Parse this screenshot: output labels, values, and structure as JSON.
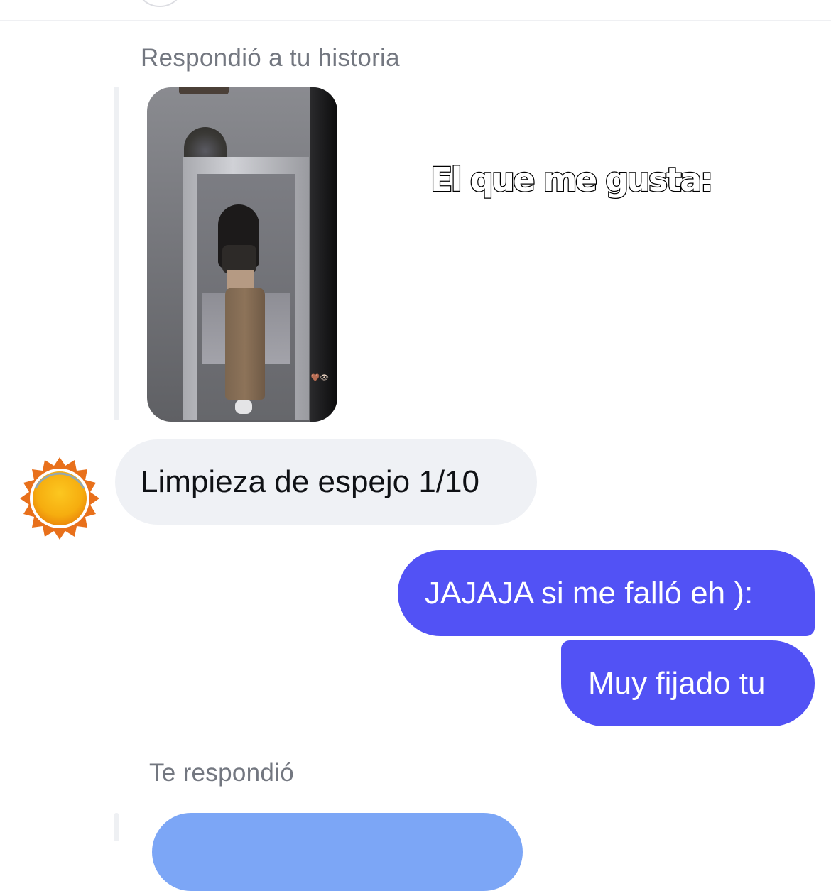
{
  "thread": {
    "story_reply_label": "Respondió a tu historia",
    "overlay_caption": "El que me gusta:",
    "story_thumbnail": {
      "icon": "story-photo-thumbnail",
      "emoji_mark": "🤎👁"
    },
    "messages": [
      {
        "sender": "them",
        "text": "Limpieza de espejo 1/10"
      },
      {
        "sender": "me",
        "text": "JAJAJA si me falló eh ):"
      },
      {
        "sender": "me",
        "text": "Muy fijado tu"
      }
    ],
    "you_reply_label": "Te respondió"
  },
  "colors": {
    "outgoing_bubble": "#5252f5",
    "incoming_bubble": "#eff1f5",
    "reply_label": "#737780",
    "partial_bubble": "#7ca6f6",
    "avatar_orange": "#e9731c",
    "avatar_yellow": "#f7b40d"
  }
}
